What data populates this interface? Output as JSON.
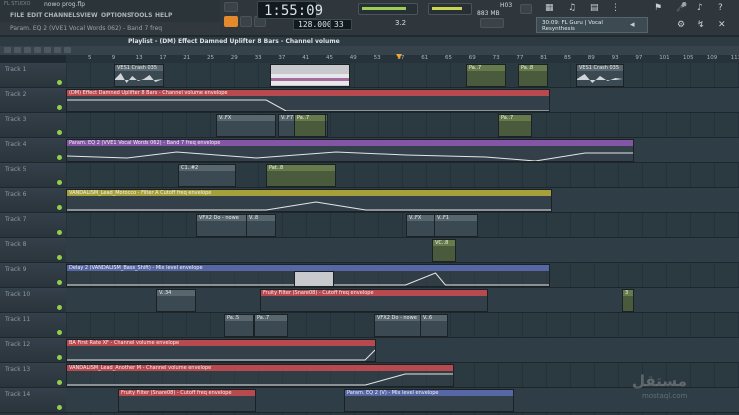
{
  "window": {
    "filename": "nowo prog.flp",
    "app_label": "FL STUDIO"
  },
  "menu": [
    "FILE",
    "EDIT",
    "CHANNELS",
    "VIEW",
    "OPTIONS",
    "TOOLS",
    "HELP"
  ],
  "hint": "Param. EQ 2 (VVE1 Vocal Words 062) - Band 7 freq",
  "transport": {
    "song_position": "1:55:09",
    "tempo": "128.000",
    "pattern": "33",
    "cpu_label": "3.2",
    "memory_label": "883 MB",
    "polyphony": "H03"
  },
  "plugin_picker": {
    "line1": "30:09: FL Guru | Vocal",
    "line2": "Resynthesis"
  },
  "playlist": {
    "title": "Playlist - (DM) Effect Damned Uplifter 8 Bars - Channel volume"
  },
  "ruler": [
    "5",
    "9",
    "13",
    "17",
    "21",
    "25",
    "29",
    "33",
    "37",
    "41",
    "45",
    "49",
    "53",
    "57",
    "61",
    "65",
    "69",
    "73",
    "77",
    "81",
    "85",
    "89",
    "93",
    "97",
    "101",
    "105",
    "109",
    "113"
  ],
  "tracks": [
    "Track 1",
    "Track 2",
    "Track 3",
    "Track 4",
    "Track 5",
    "Track 6",
    "Track 7",
    "Track 8",
    "Track 9",
    "Track 10",
    "Track 11",
    "Track 12",
    "Track 13",
    "Track 14"
  ],
  "clips": {
    "t1a": "VES1 Crash 035",
    "t1b": "Pa..7",
    "t1c": "Pa..8",
    "t1d": "VES1 Crash 035",
    "t2": "(DM) Effect Damned Uplifter 8 Bars - Channel volume envelope",
    "t3a": "V..FX",
    "t3b": "V..F7",
    "t3c": "Pa..7",
    "t3d": "Pa..7",
    "t4": "Param. EQ 2 (VVE1 Vocal Words 062) - Band 7 freq envelope",
    "t5a": "C1..#2",
    "t5b": "Pat..8",
    "t6": "VANDALISM_Lead_Morocco - Filter A Cutoff freq envelope",
    "t7a": "VFX2 Do - nowe",
    "t7b": "V..8",
    "t7c": "V..FX",
    "t7d": "V..F1",
    "t8": "VC..8",
    "t9": "Delay 2 (VANDALISM_Bass_Shift) - Mix level envelope",
    "t10a": "V..34",
    "t10b": "Fruity Filter (Snare08) - Cutoff freq envelope",
    "t10c": "3",
    "t11a": "Pa..5",
    "t11b": "Pa..7",
    "t11c": "VFX2 Do - nowe",
    "t11d": "V..6",
    "t12": "BA First Rate XF - Channel volume envelope",
    "t13": "VANDALISM_Lead_Another M - Channel volume envelope",
    "t14a": "Fruity Filter (Snare08) - Cutoff freq envelope",
    "t14b": "Param. EQ 2 (V) - Mix level envelope"
  },
  "watermark": {
    "arabic": "مستقل",
    "latin": "mostaql.com"
  }
}
